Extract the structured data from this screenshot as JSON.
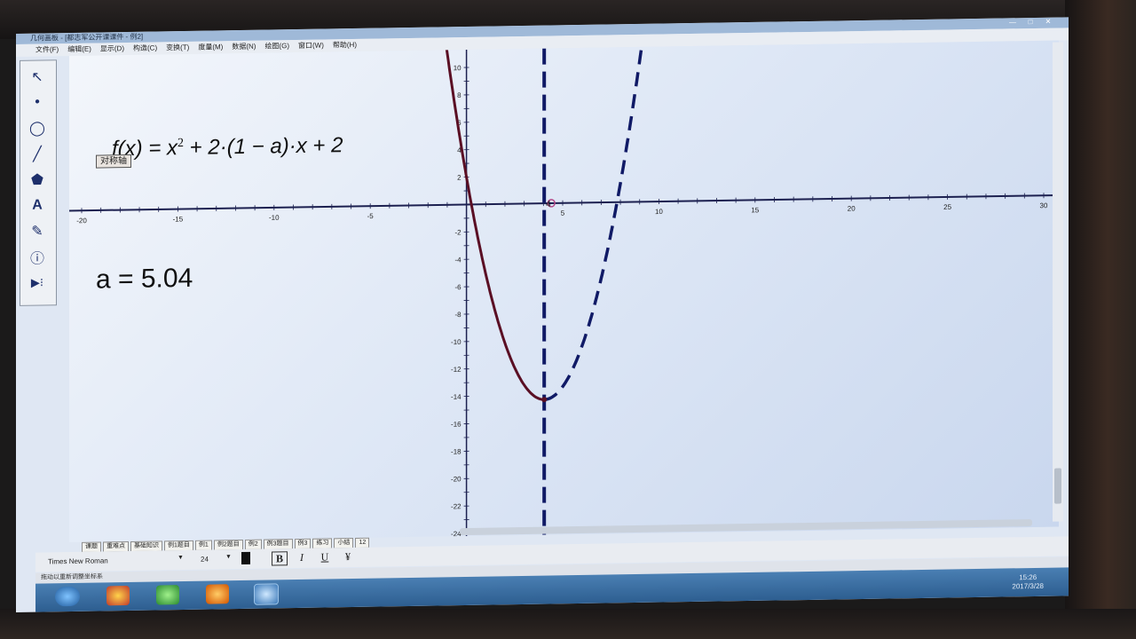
{
  "window": {
    "title": "几何画板 - [都志军公开课课件 - 例2]",
    "buttons": [
      "—",
      "□",
      "✕"
    ]
  },
  "menu": [
    "文件(F)",
    "编辑(E)",
    "显示(D)",
    "构造(C)",
    "变换(T)",
    "度量(M)",
    "数据(N)",
    "绘图(G)",
    "窗口(W)",
    "帮助(H)"
  ],
  "tools": [
    {
      "name": "arrow-tool",
      "glyph": "↖"
    },
    {
      "name": "point-tool",
      "glyph": "•"
    },
    {
      "name": "compass-tool",
      "glyph": "◯"
    },
    {
      "name": "line-tool",
      "glyph": "╱"
    },
    {
      "name": "polygon-tool",
      "glyph": "⬟"
    },
    {
      "name": "text-tool",
      "glyph": "A"
    },
    {
      "name": "marker-tool",
      "glyph": "✎"
    },
    {
      "name": "info-tool",
      "glyph": "ⓘ"
    },
    {
      "name": "custom-tool",
      "glyph": "▶⁝"
    }
  ],
  "formula": {
    "prefix": "f(x) = x",
    "exp": "2",
    "suffix": " + 2·(1 − a)·x + 2"
  },
  "symmetry_button": "对称轴",
  "parameter": "a = 5.04",
  "graph": {
    "x_range": [
      -20,
      30
    ],
    "y_range": [
      -24,
      10
    ],
    "a": 5.04,
    "x_ticks": [
      -20,
      -15,
      -10,
      -5,
      5,
      10,
      15,
      20,
      25,
      30
    ],
    "y_ticks": [
      10,
      8,
      6,
      4,
      2,
      -2,
      -4,
      -6,
      -8,
      -10,
      -12,
      -14,
      -16,
      -18,
      -20,
      -22,
      -24
    ],
    "vertex_label": "4",
    "curve_color": "#5a0f24",
    "dash_color": "#101a66"
  },
  "page_tabs": [
    "课题",
    "重难点",
    "基础知识",
    "例1题目",
    "例1",
    "例2题目",
    "例2",
    "例3题目",
    "例3",
    "练习",
    "小结",
    "12"
  ],
  "text_toolbar": {
    "font": "Times New Roman",
    "size": "24",
    "bold": "B",
    "italic": "I",
    "underline": "U",
    "special": "¥"
  },
  "status": "拖动以重新调整坐标系",
  "clock": {
    "time": "15:26",
    "date": "2017/3/28"
  }
}
